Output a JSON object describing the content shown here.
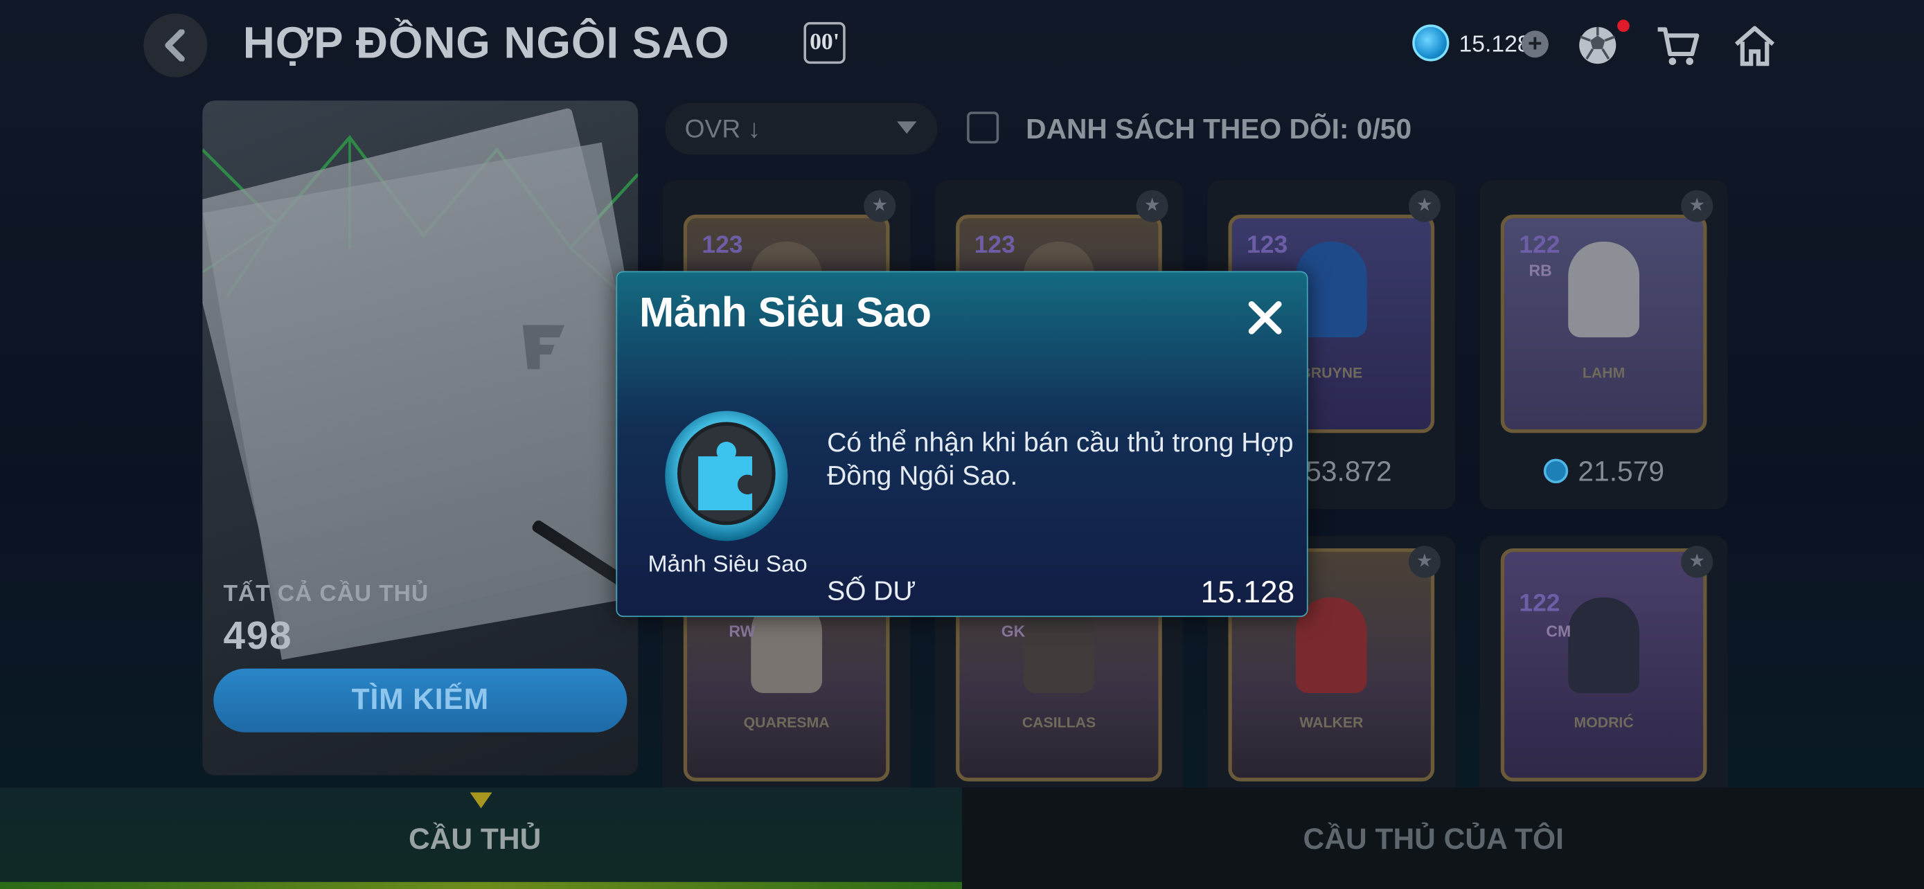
{
  "header": {
    "title": "HỢP ĐỒNG NGÔI SAO",
    "season_badge": "00'",
    "coin_balance": "15.128",
    "icons": [
      "back-arrow-icon",
      "coin-icon",
      "plus-icon",
      "ball-icon",
      "cart-icon",
      "home-icon"
    ]
  },
  "left_panel": {
    "count_label": "TẤT CẢ CẦU THỦ",
    "count_value": "498",
    "search_label": "TÌM KIẾM"
  },
  "filters": {
    "sort_label": "OVR ↓",
    "watchlist_label": "DANH SÁCH THEO DÕI: 0/50",
    "watchlist_checked": false
  },
  "cards": [
    {
      "ovr": "123",
      "position": "",
      "name": "",
      "price": ""
    },
    {
      "ovr": "123",
      "position": "",
      "name": "",
      "price": ""
    },
    {
      "ovr": "123",
      "position": "",
      "name": "BRUYNE",
      "price": "53.872"
    },
    {
      "ovr": "122",
      "position": "RB",
      "name": "LAHM",
      "price": "21.579"
    },
    {
      "ovr": "",
      "position": "RW",
      "name": "QUARESMA",
      "price": ""
    },
    {
      "ovr": "",
      "position": "GK",
      "name": "CASILLAS",
      "price": ""
    },
    {
      "ovr": "",
      "position": "",
      "name": "WALKER",
      "price": ""
    },
    {
      "ovr": "122",
      "position": "CM",
      "name": "MODRIĆ",
      "price": ""
    }
  ],
  "tabs": [
    {
      "label": "CẦU THỦ",
      "active": true
    },
    {
      "label": "CẦU THỦ CỦA TÔI",
      "active": false
    }
  ],
  "modal": {
    "title": "Mảnh Siêu Sao",
    "item_caption": "Mảnh Siêu Sao",
    "description": "Có thể nhận khi bán cầu thủ trong Hợp Đồng Ngôi Sao.",
    "balance_label": "SỐ DƯ",
    "balance_value": "15.128",
    "icons": [
      "close-icon",
      "puzzle-piece-icon"
    ]
  },
  "colors": {
    "accent": "#3fa2b2",
    "coin": "#1b8fd2",
    "tab_indicator": "#a79620"
  }
}
